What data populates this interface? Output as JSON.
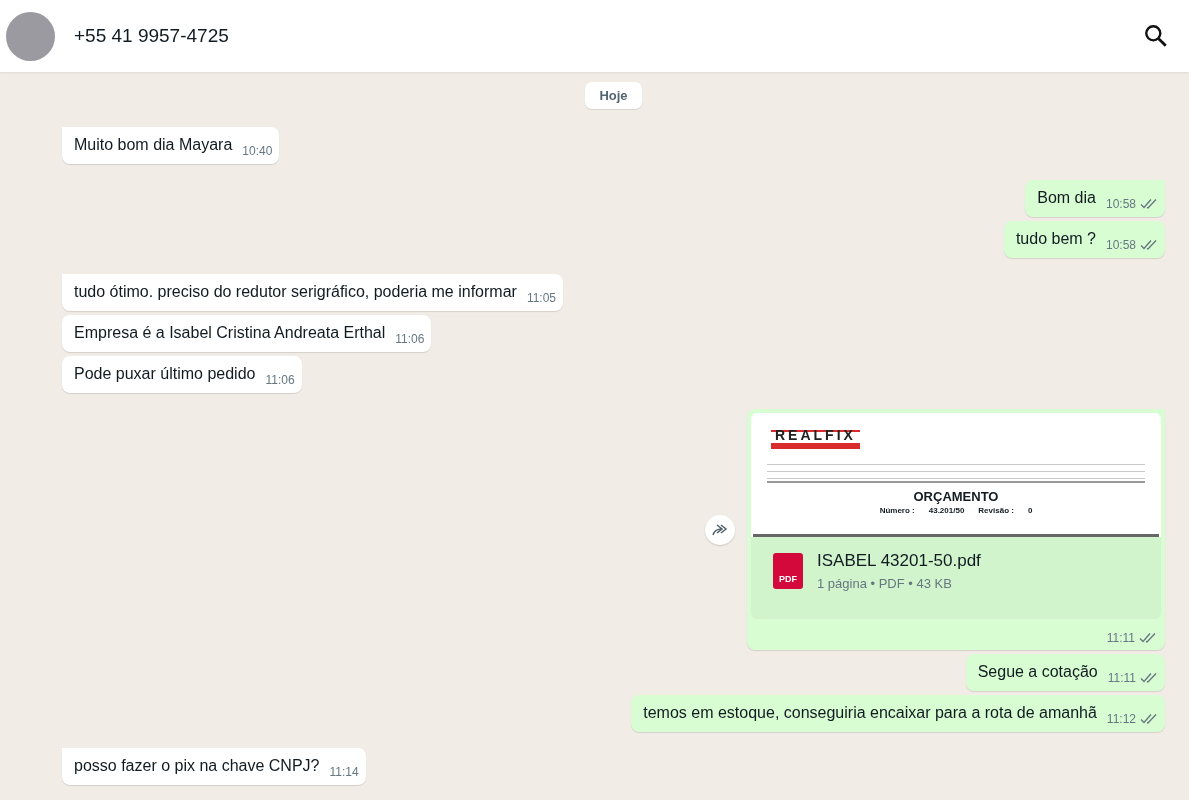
{
  "header": {
    "contact": "+55 41 9957-4725"
  },
  "date_chip": "Hoje",
  "messages": [
    {
      "kind": "text",
      "outgoing": false,
      "tail": true,
      "text": "Muito bom dia Mayara",
      "time": "10:40"
    },
    {
      "kind": "text",
      "outgoing": true,
      "tail": true,
      "text": "Bom dia",
      "time": "10:58",
      "read": false
    },
    {
      "kind": "text",
      "outgoing": true,
      "tail": false,
      "text": "tudo bem ?",
      "time": "10:58",
      "read": false
    },
    {
      "kind": "text",
      "outgoing": false,
      "tail": true,
      "text": "tudo ótimo. preciso do redutor serigráfico, poderia me informar",
      "time": "11:05"
    },
    {
      "kind": "text",
      "outgoing": false,
      "tail": false,
      "text": "Empresa é a Isabel Cristina Andreata Erthal",
      "time": "11:06"
    },
    {
      "kind": "text",
      "outgoing": false,
      "tail": false,
      "text": "Pode puxar último pedido",
      "time": "11:06"
    },
    {
      "kind": "document",
      "outgoing": true,
      "tail": true,
      "preview": {
        "logo": "REALFIX",
        "title": "ORÇAMENTO",
        "number_label": "Número :",
        "number": "43.201/50",
        "revision_label": "Revisão :",
        "revision": "0"
      },
      "file_icon_label": "PDF",
      "file_name": "ISABEL 43201-50.pdf",
      "meta": "1 página • PDF • 43 KB",
      "time": "11:11",
      "read": false
    },
    {
      "kind": "text",
      "outgoing": true,
      "tail": false,
      "text": "Segue a cotação",
      "time": "11:11",
      "read": false
    },
    {
      "kind": "text",
      "outgoing": true,
      "tail": false,
      "text": "temos em estoque, conseguiria encaixar para a rota de amanhã",
      "time": "11:12",
      "read": false
    },
    {
      "kind": "text",
      "outgoing": false,
      "tail": true,
      "text": "posso fazer o pix na chave CNPJ?",
      "time": "11:14"
    }
  ]
}
